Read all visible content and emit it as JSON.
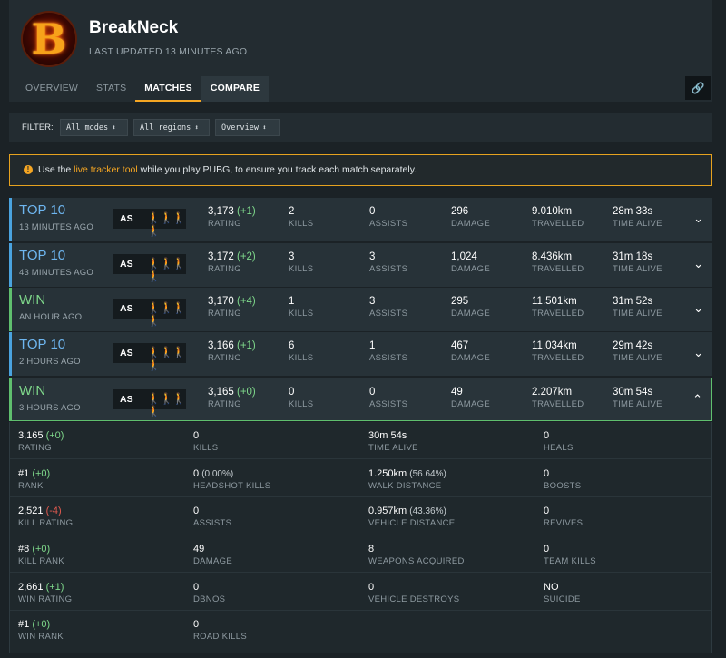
{
  "player": {
    "name": "BreakNeck",
    "avatar_letter": "B",
    "last_updated": "LAST UPDATED 13 MINUTES AGO"
  },
  "tabs": [
    "OVERVIEW",
    "STATS",
    "MATCHES",
    "COMPARE"
  ],
  "link_icon": "🔗",
  "filter": {
    "label": "FILTER:",
    "modes": "All modes",
    "regions": "All regions",
    "view": "Overview"
  },
  "notice": {
    "pre": "Use the ",
    "link": "live tracker tool",
    "post": " while you play PUBG, to ensure you track each match separately."
  },
  "labels": {
    "rating": "RATING",
    "kills": "KILLS",
    "assists": "ASSISTS",
    "damage": "DAMAGE",
    "travelled": "TRAVELLED",
    "time_alive": "TIME ALIVE"
  },
  "matches": [
    {
      "placement": "TOP 10",
      "when": "13 MINUTES AGO",
      "region": "AS",
      "squad": "🚶🚶🚶🚶",
      "rating": "3,173",
      "rating_delta": "(+1)",
      "kills": "2",
      "assists": "0",
      "damage": "296",
      "travelled": "9.010km",
      "time_alive": "28m 33s"
    },
    {
      "placement": "TOP 10",
      "when": "43 MINUTES AGO",
      "region": "AS",
      "squad": "🚶🚶🚶🚶",
      "rating": "3,172",
      "rating_delta": "(+2)",
      "kills": "3",
      "assists": "3",
      "damage": "1,024",
      "travelled": "8.436km",
      "time_alive": "31m 18s"
    },
    {
      "placement": "WIN",
      "when": "AN HOUR AGO",
      "region": "AS",
      "squad": "🚶🚶🚶🚶",
      "rating": "3,170",
      "rating_delta": "(+4)",
      "kills": "1",
      "assists": "3",
      "damage": "295",
      "travelled": "11.501km",
      "time_alive": "31m 52s"
    },
    {
      "placement": "TOP 10",
      "when": "2 HOURS AGO",
      "region": "AS",
      "squad": "🚶🚶🚶🚶",
      "rating": "3,166",
      "rating_delta": "(+1)",
      "kills": "6",
      "assists": "1",
      "damage": "467",
      "travelled": "11.034km",
      "time_alive": "29m 42s"
    },
    {
      "placement": "WIN",
      "when": "3 HOURS AGO",
      "region": "AS",
      "squad": "🚶🚶🚶🚶",
      "rating": "3,165",
      "rating_delta": "(+0)",
      "kills": "0",
      "assists": "0",
      "damage": "49",
      "travelled": "2.207km",
      "time_alive": "30m 54s"
    }
  ],
  "details": {
    "col1": [
      {
        "value": "3,165",
        "delta": "(+0)",
        "label": "RATING"
      },
      {
        "value": "#1",
        "delta": "(+0)",
        "label": "RANK"
      },
      {
        "value": "2,521",
        "delta": "(-4)",
        "label": "KILL RATING"
      },
      {
        "value": "#8",
        "delta": "(+0)",
        "label": "KILL RANK"
      },
      {
        "value": "2,661",
        "delta": "(+1)",
        "label": "WIN RATING"
      },
      {
        "value": "#1",
        "delta": "(+0)",
        "label": "WIN RANK"
      }
    ],
    "col2": [
      {
        "value": "0",
        "extra": "",
        "label": "KILLS"
      },
      {
        "value": "0",
        "extra": "(0.00%)",
        "label": "HEADSHOT KILLS"
      },
      {
        "value": "0",
        "extra": "",
        "label": "ASSISTS"
      },
      {
        "value": "49",
        "extra": "",
        "label": "DAMAGE"
      },
      {
        "value": "0",
        "extra": "",
        "label": "DBNOS"
      },
      {
        "value": "0",
        "extra": "",
        "label": "ROAD KILLS"
      }
    ],
    "col3": [
      {
        "value": "30m 54s",
        "extra": "",
        "label": "TIME ALIVE"
      },
      {
        "value": "1.250km",
        "extra": "(56.64%)",
        "label": "WALK DISTANCE"
      },
      {
        "value": "0.957km",
        "extra": "(43.36%)",
        "label": "VEHICLE DISTANCE"
      },
      {
        "value": "8",
        "extra": "",
        "label": "WEAPONS ACQUIRED"
      },
      {
        "value": "0",
        "extra": "",
        "label": "VEHICLE DESTROYS"
      }
    ],
    "col4": [
      {
        "value": "0",
        "label": "HEALS"
      },
      {
        "value": "0",
        "label": "BOOSTS"
      },
      {
        "value": "0",
        "label": "REVIVES"
      },
      {
        "value": "0",
        "label": "TEAM KILLS"
      },
      {
        "value": "NO",
        "label": "SUICIDE"
      }
    ]
  }
}
